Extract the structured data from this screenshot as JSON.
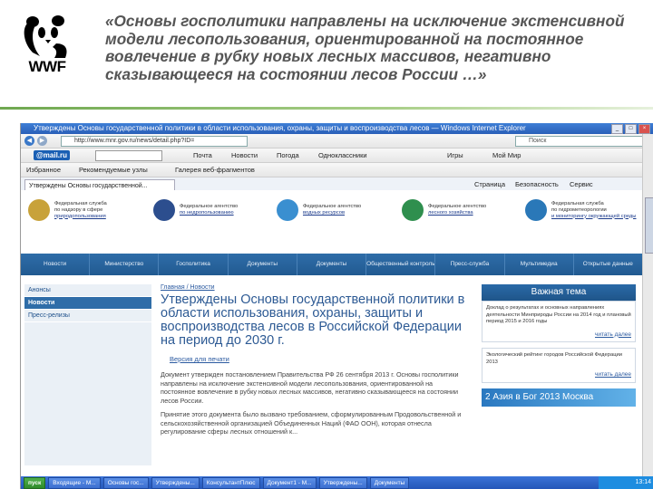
{
  "slide": {
    "logo_text": "WWF",
    "quote": "«Основы госполитики направлены на исключение экстенсивной модели лесопользования, ориентированной на постоянное вовлечение в рубку новых лесных массивов, негативно сказывающееся на состоянии лесов России …»",
    "accent_color": "#6fa850"
  },
  "browser": {
    "window_title": "Утверждены Основы государственной политики в области использования, охраны, защиты и воспроизводства лесов — Windows Internet Explorer",
    "address": "http://www.mnr.gov.ru/news/detail.php?ID=",
    "search_placeholder": "Поиск",
    "toolbar1": {
      "brand": "@mail.ru",
      "items": [
        "Почта",
        "Новости",
        "Погода",
        "Одноклассники",
        "Игры",
        "Мой Мир"
      ]
    },
    "toolbar2": {
      "items": [
        "Избранное",
        "Рекомендуемые узлы",
        "Галерея веб-фрагментов"
      ]
    },
    "tab_label": "Утверждены Основы государственной...",
    "cmd_items": [
      "Страница",
      "Безопасность",
      "Сервис"
    ]
  },
  "site": {
    "orgs": [
      {
        "line1": "Федеральная служба",
        "line2": "по надзору в сфере",
        "line3": "природопользования",
        "color": "#c8a23a"
      },
      {
        "line1": "Федеральное агентство",
        "line2": "по недропользованию",
        "line3": "",
        "color": "#2c4e8e"
      },
      {
        "line1": "Федеральное агентство",
        "line2": "водных ресурсов",
        "line3": "",
        "color": "#3a8fd0"
      },
      {
        "line1": "Федеральное агентство",
        "line2": "лесного хозяйства",
        "line3": "",
        "color": "#2f8f4e"
      },
      {
        "line1": "Федеральная служба",
        "line2": "по гидрометеорологии",
        "line3": "и мониторингу окружающей среды",
        "color": "#2a78b8"
      }
    ],
    "nav": [
      "Новости",
      "Министерство",
      "Госполитика",
      "Документы",
      "Документы",
      "Общественный контроль",
      "Пресс-служба",
      "Мультимедиа",
      "Открытые данные"
    ],
    "sidebar": [
      "Анонсы",
      "Новости",
      "Пресс-релизы"
    ],
    "breadcrumb": "Главная / Новости",
    "article_title": "Утверждены Основы государственной политики в области использования, охраны, защиты и воспроизводства лесов в Российской Федерации на период до 2030 г.",
    "print_link": "Версия для печати",
    "paragraphs": [
      "Документ утвержден постановлением Правительства РФ 26 сентября 2013 г. Основы госполитики направлены на исключение экстенсивной модели лесопользования, ориентированной на постоянное вовлечение в рубку новых лесных массивов, негативно сказывающееся на состоянии лесов России.",
      "Принятие этого документа было вызвано требованием, сформулированным Продовольственной и сельскохозяйственной организацией Объединенных Наций (ФАО ООН), которая отнесла регулирование сферы лесных отношений к..."
    ],
    "right": {
      "head": "Важная тема",
      "box1": "Доклад о результатах и основных направлениях деятельности Минприроды России на 2014 год и плановый период 2015 и 2016 годы",
      "more1": "читать далее",
      "box2": "Экологический рейтинг городов Российской Федерации 2013",
      "more2": "читать далее",
      "banner": "2 Азия в Бог 2013 Москва"
    }
  },
  "taskbar": {
    "items": [
      "пуск",
      "Входящие - M...",
      "Основы гос...",
      "Утверждены...",
      "КонсультантПлюс",
      "Документ1 - M...",
      "Утверждены...",
      "Документы"
    ],
    "clock": "13:14"
  }
}
